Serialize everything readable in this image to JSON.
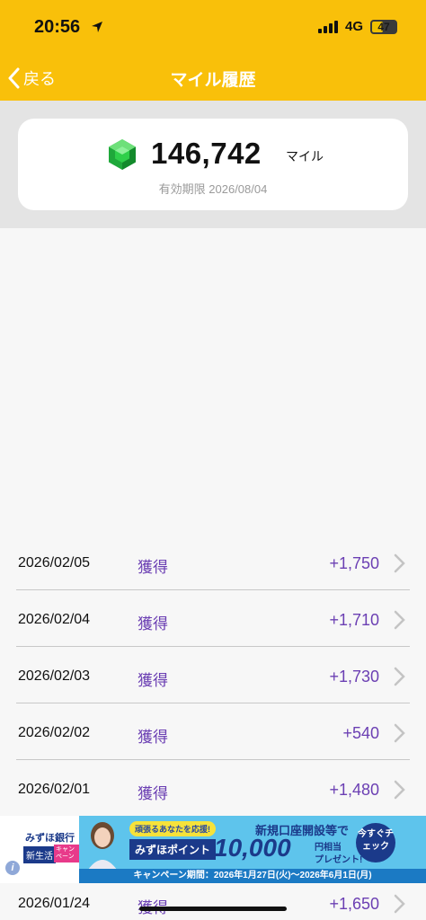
{
  "status": {
    "time": "20:56",
    "network": "4G",
    "battery": "47",
    "battery_level": 0.47
  },
  "nav": {
    "back_label": "戻る",
    "title": "マイル履歴"
  },
  "summary": {
    "miles": "146,742",
    "unit": "マイル",
    "expiry": "有効期限 2026/08/04"
  },
  "history": [
    {
      "date": "2026/02/05",
      "type": "獲得",
      "amount": "+1,750"
    },
    {
      "date": "2026/02/04",
      "type": "獲得",
      "amount": "+1,710"
    },
    {
      "date": "2026/02/03",
      "type": "獲得",
      "amount": "+1,730"
    },
    {
      "date": "2026/02/02",
      "type": "獲得",
      "amount": "+540"
    },
    {
      "date": "2026/02/01",
      "type": "獲得",
      "amount": "+1,480"
    },
    {
      "date": "2026/01/24",
      "type": "獲得",
      "amount": "+1,650"
    }
  ],
  "ad": {
    "bank": "みずほ銀行",
    "tag": "新生活",
    "tag2": "キャンペーン",
    "pill": "頑張るあなたを応援!",
    "headline": "新規口座開設等で",
    "point": "みずほポイント",
    "amount": "10,000",
    "yen": "円相当",
    "present": "プレゼント!",
    "cta": "今すぐチェック",
    "footer": "キャンペーン期間：2026年1月27日(火)〜2026年6月1日(月)"
  },
  "colors": {
    "brand": "#f9c00a",
    "amount": "#6b3fb3"
  },
  "icons": [
    "location-arrow-icon",
    "signal-icon",
    "battery-icon",
    "back-chevron-icon",
    "gem-icon",
    "chevron-right-icon",
    "info-icon"
  ]
}
